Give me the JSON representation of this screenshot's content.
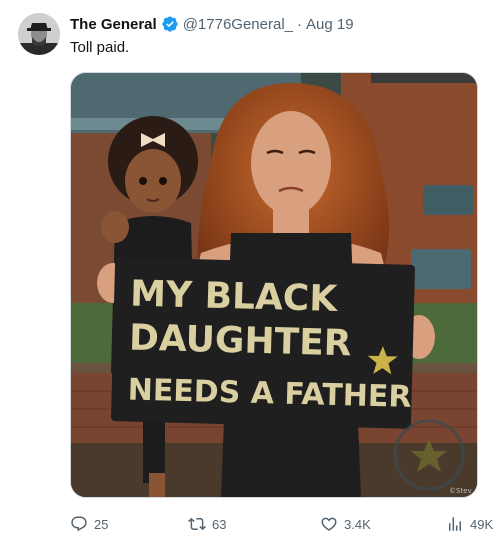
{
  "tweet": {
    "author": {
      "display_name": "The General",
      "handle": "@1776General_",
      "verified": true,
      "avatar_icon": "avatar-portrait"
    },
    "separator": "·",
    "date": "Aug 19",
    "text": "Toll paid.",
    "media": {
      "sign_lines": [
        "MY BLACK",
        "DAUGHTER",
        "NEEDS A FATHER"
      ],
      "signature": "©Stev"
    },
    "actions": {
      "replies": "25",
      "reposts": "63",
      "likes": "3.4K",
      "views": "49K"
    }
  },
  "colors": {
    "verified": "#1d9bf0",
    "muted": "#536471",
    "text": "#0f1419"
  }
}
